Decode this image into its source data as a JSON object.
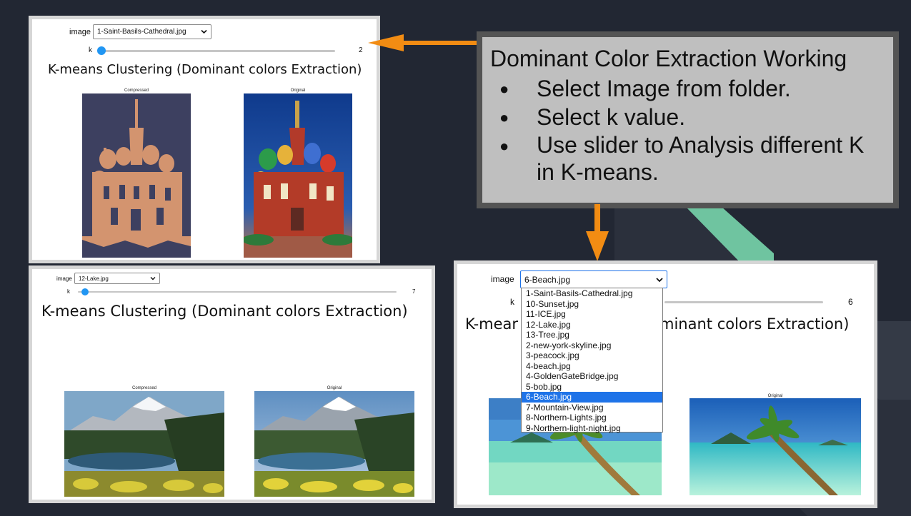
{
  "callout": {
    "title": "Dominant Color Extraction Working",
    "bullet_glyph": "●",
    "bullets": [
      "Select Image from folder.",
      "Select k value.",
      "Use slider to Analysis different K in K-means."
    ]
  },
  "panel_top": {
    "image_label": "image",
    "selected_image": "1-Saint-Basils-Cathedral.jpg",
    "k_label": "k",
    "k_value": "2",
    "heading": "K-means Clustering (Dominant colors Extraction)",
    "left_caption": "Compressed",
    "right_caption": "Original"
  },
  "panel_lake": {
    "image_label": "image",
    "selected_image": "12-Lake.jpg",
    "k_label": "k",
    "k_value": "7",
    "heading": "K-means Clustering (Dominant colors Extraction)",
    "left_caption": "Compressed",
    "right_caption": "Original"
  },
  "panel_beach": {
    "image_label": "image",
    "selected_image": "6-Beach.jpg",
    "k_label": "k",
    "k_value": "6",
    "heading_left": "K-mear",
    "heading_right": "minant colors Extraction)",
    "right_caption": "Original",
    "dropdown_options": [
      "1-Saint-Basils-Cathedral.jpg",
      "10-Sunset.jpg",
      "11-ICE.jpg",
      "12-Lake.jpg",
      "13-Tree.jpg",
      "2-new-york-skyline.jpg",
      "3-peacock.jpg",
      "4-beach.jpg",
      "4-GoldenGateBridge.jpg",
      "5-bob.jpg",
      "6-Beach.jpg",
      "7-Mountain-View.jpg",
      "8-Northern-Lights.jpg",
      "9-Northern-light-night.jpg"
    ],
    "highlighted_option": "6-Beach.jpg"
  },
  "colors": {
    "background": "#222733",
    "arrow": "#f28c13",
    "callout_fill": "#bfbfbf",
    "callout_border": "#545454",
    "slider_handle": "#2196f3",
    "dropdown_highlight": "#1e73e8",
    "accent_green": "#6fc4a0"
  }
}
